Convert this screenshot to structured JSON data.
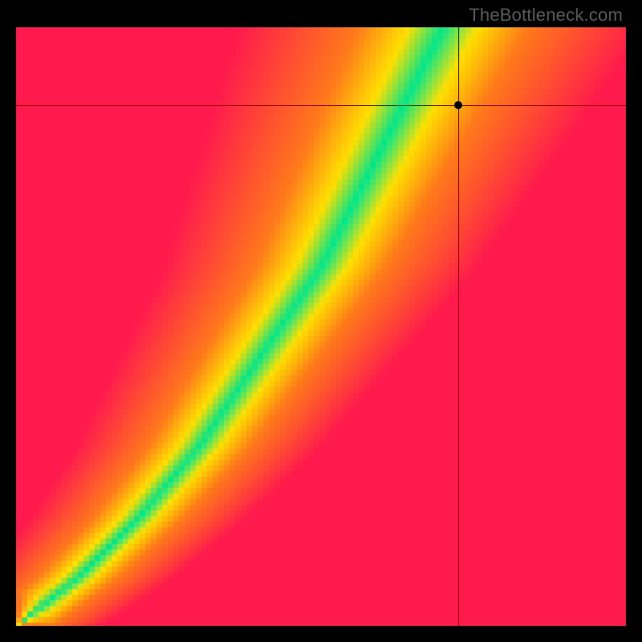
{
  "watermark": "TheBottleneck.com",
  "chart_data": {
    "type": "heatmap",
    "title": "",
    "xlabel": "",
    "ylabel": "",
    "xlim": [
      0,
      100
    ],
    "ylim": [
      0,
      100
    ],
    "grid": false,
    "legend": false,
    "marker": {
      "x": 72.5,
      "y": 87.0
    },
    "crosshair": {
      "h_at_y": 87.0,
      "v_at_x": 72.5
    },
    "optimal_ridge": {
      "description": "Green optimal band runs diagonally from bottom-left toward top-right; falloff through yellow→orange→red on both sides. Band slopes steeper than 1:1 so the green crosses x≈70 at top.",
      "points_xy": [
        [
          0,
          0
        ],
        [
          10,
          8
        ],
        [
          20,
          18
        ],
        [
          30,
          30
        ],
        [
          40,
          45
        ],
        [
          50,
          60
        ],
        [
          55,
          70
        ],
        [
          60,
          80
        ],
        [
          65,
          90
        ],
        [
          70,
          100
        ]
      ],
      "band_halfwidth_x_pct": 4.0
    },
    "colors": {
      "optimal": "#00E68C",
      "mid": "#FFE000",
      "warm": "#FF7A1A",
      "bad": "#FF1A4D"
    }
  }
}
